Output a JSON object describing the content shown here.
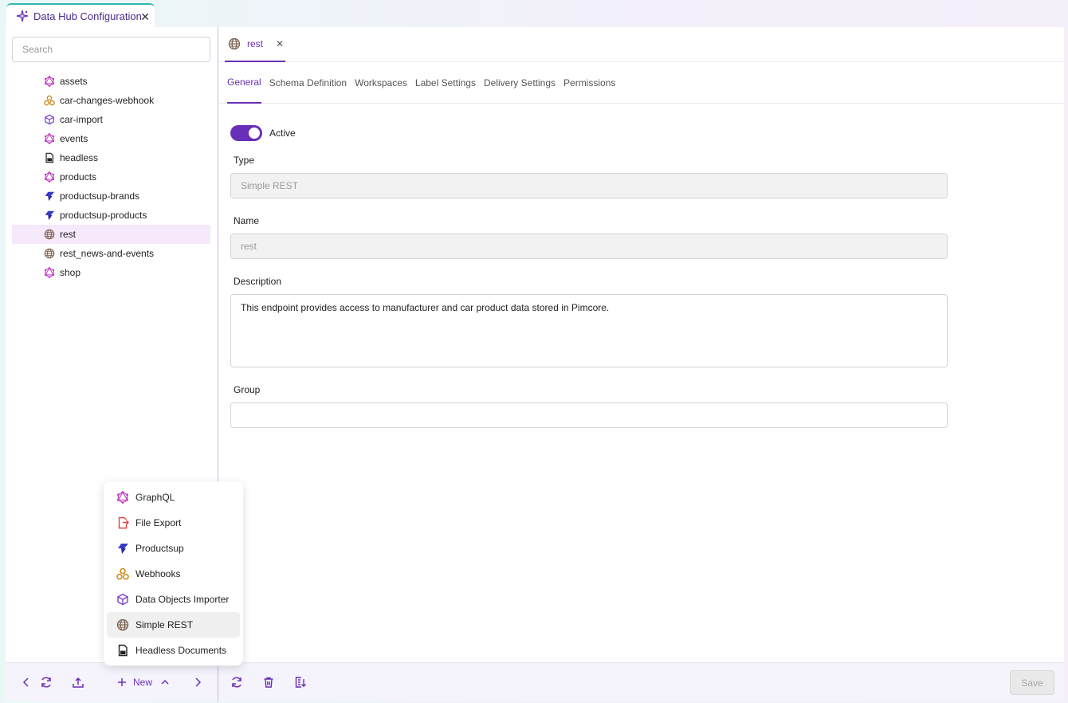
{
  "window_tab": {
    "title": "Data Hub Configuration",
    "close": "✕"
  },
  "sidebar": {
    "search_placeholder": "Search",
    "items": [
      {
        "label": "assets",
        "icon": "graphql-icon"
      },
      {
        "label": "car-changes-webhook",
        "icon": "webhook-icon"
      },
      {
        "label": "car-import",
        "icon": "data-importer-icon"
      },
      {
        "label": "events",
        "icon": "graphql-icon"
      },
      {
        "label": "headless",
        "icon": "document-icon"
      },
      {
        "label": "products",
        "icon": "graphql-icon"
      },
      {
        "label": "productsup-brands",
        "icon": "productsup-icon"
      },
      {
        "label": "productsup-products",
        "icon": "productsup-icon"
      },
      {
        "label": "rest",
        "icon": "globe-icon",
        "selected": true
      },
      {
        "label": "rest_news-and-events",
        "icon": "globe-icon"
      },
      {
        "label": "shop",
        "icon": "graphql-icon"
      }
    ]
  },
  "doc_tab": {
    "label": "rest",
    "close": "✕"
  },
  "sub_tabs": [
    {
      "label": "General",
      "active": true
    },
    {
      "label": "Schema Definition"
    },
    {
      "label": "Workspaces"
    },
    {
      "label": "Label Settings"
    },
    {
      "label": "Delivery Settings"
    },
    {
      "label": "Permissions"
    }
  ],
  "form": {
    "active_label": "Active",
    "active": true,
    "type_label": "Type",
    "type_value": "Simple REST",
    "name_label": "Name",
    "name_value": "rest",
    "description_label": "Description",
    "description_value": "This endpoint provides access to manufacturer and car product data stored in Pimcore.",
    "group_label": "Group",
    "group_value": ""
  },
  "new_menu": {
    "items": [
      {
        "label": "GraphQL",
        "icon": "graphql-icon"
      },
      {
        "label": "File Export",
        "icon": "file-export-icon"
      },
      {
        "label": "Productsup",
        "icon": "productsup-icon"
      },
      {
        "label": "Webhooks",
        "icon": "webhook-icon"
      },
      {
        "label": "Data Objects Importer",
        "icon": "data-importer-icon"
      },
      {
        "label": "Simple REST",
        "icon": "globe-icon",
        "hover": true
      },
      {
        "label": "Headless Documents",
        "icon": "document-icon"
      }
    ]
  },
  "bottom_bar": {
    "new_label": "New",
    "save_label": "Save"
  },
  "colors": {
    "accent": "#6a2fb8",
    "graphql": "#c03ac0",
    "webhook": "#d08a1c",
    "productsup": "#3a3ac8",
    "file_export": "#e04040"
  }
}
